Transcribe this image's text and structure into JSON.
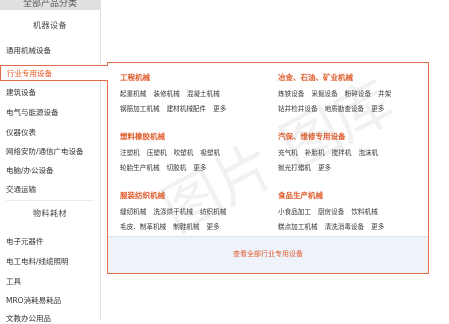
{
  "sidebar": {
    "header": "全部产品分类",
    "group1_title": "机器设备",
    "group1_items": [
      "通用机械设备",
      "行业专用设备",
      "建筑设备",
      "电气与能源设备",
      "仪器仪表",
      "网络安防/通信广电设备",
      "电脑/办公设备",
      "交通运输"
    ],
    "group2_title": "物料耗材",
    "group2_items": [
      "电子元器件",
      "电工电料/线缆照明",
      "工具",
      "MRO消耗易耗品",
      "文教办公用品"
    ]
  },
  "panel": {
    "categories": [
      {
        "title": "工程机械",
        "rows": [
          [
            "起重机械",
            "装修机械",
            "混凝土机械"
          ],
          [
            "钢筋加工机械",
            "建材机械配件",
            "更多"
          ]
        ]
      },
      {
        "title": "冶金、石油、矿业机械",
        "rows": [
          [
            "炼铁设备",
            "采掘设备",
            "粉碎设备",
            "井架"
          ],
          [
            "钻井检井设备",
            "地质勘查设备",
            "更多"
          ]
        ]
      },
      {
        "title": "塑料橡胶机械",
        "rows": [
          [
            "注塑机",
            "压塑机",
            "吹塑机",
            "吸塑机"
          ],
          [
            "轮胎生产机械",
            "切胶机",
            "更多"
          ]
        ]
      },
      {
        "title": "汽保、维修专用设备",
        "rows": [
          [
            "充气机",
            "补胎机",
            "搅拌机",
            "泡沫机"
          ],
          [
            "抛光打蜡机",
            "更多"
          ]
        ]
      },
      {
        "title": "服装纺织机械",
        "rows": [
          [
            "缝纫机械",
            "洗涤烘干机械",
            "纺织机械"
          ],
          [
            "毛皮、制革机械",
            "制鞋机械",
            "更多"
          ]
        ]
      },
      {
        "title": "食品生产机械",
        "rows": [
          [
            "小食品加工",
            "厨房设备",
            "饮料机械"
          ],
          [
            "糕点加工机械",
            "清洗消毒设备",
            "更多"
          ]
        ]
      }
    ],
    "footer_link": "查看全部行业专用设备"
  },
  "watermark": "图片 图库"
}
